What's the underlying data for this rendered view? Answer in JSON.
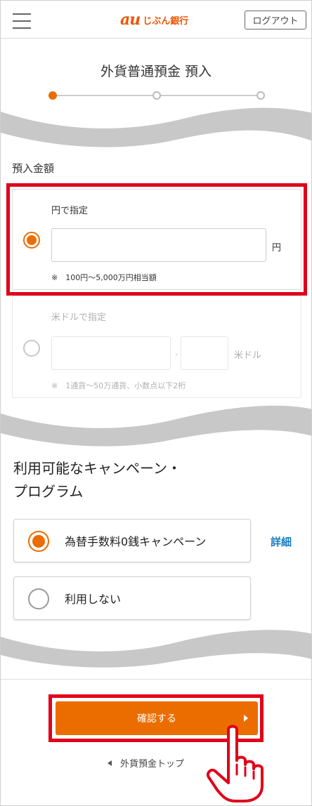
{
  "header": {
    "logo_au": "au",
    "logo_bank": "じぶん銀行",
    "logout_label": "ログアウト"
  },
  "page": {
    "title": "外貨普通預金 預入",
    "steps": 3,
    "current_step": 1
  },
  "amount": {
    "section_label": "預入金額",
    "yen_option": {
      "title": "円で指定",
      "value": "",
      "unit": "円",
      "note": "※　100円〜5,000万円相当額",
      "selected": true
    },
    "usd_option": {
      "title": "米ドルで指定",
      "integer_value": "",
      "separator": ".",
      "decimal_value": "",
      "unit": "米ドル",
      "note": "※　1通貨〜50万通貨、小数点以下2桁",
      "selected": false
    }
  },
  "campaign": {
    "title_line1": "利用可能なキャンペーン・",
    "title_line2": "プログラム",
    "options": [
      {
        "label": "為替手数料0銭キャンペーン",
        "selected": true
      },
      {
        "label": "利用しない",
        "selected": false
      }
    ],
    "detail_label": "詳細"
  },
  "footer": {
    "confirm_label": "確認する",
    "back_label": "外貨預金トップ"
  },
  "colors": {
    "accent": "#eb6d00",
    "highlight": "#e0001a",
    "link": "#1a7fc1",
    "wave": "#c8c8c8"
  }
}
